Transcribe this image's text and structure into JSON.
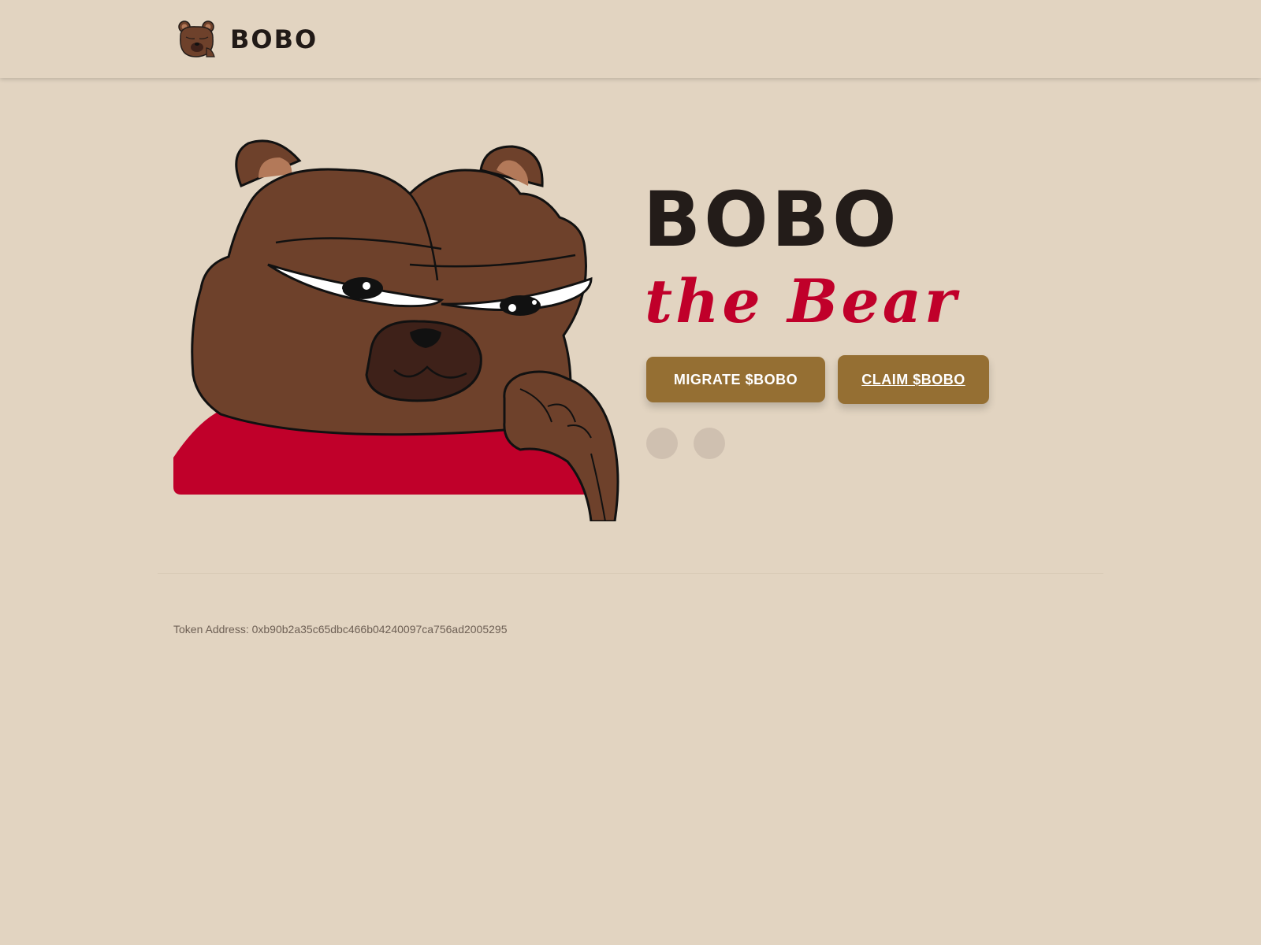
{
  "header": {
    "logo_icon": "bear-face-icon",
    "brand": "BOBO"
  },
  "hero": {
    "title": "BOBO",
    "subtitle": "the Bear",
    "image": "bear-thinking-illustration",
    "buttons": {
      "migrate": "MIGRATE $BOBO",
      "claim": "CLAIM $BOBO"
    },
    "social_icons": [
      "social-icon-1",
      "social-icon-2"
    ]
  },
  "footer": {
    "token_address": "Token Address: 0xb90b2a35c65dbc466b04240097ca756ad2005295"
  },
  "colors": {
    "background": "#e2d4c1",
    "bear_brown": "#6e412b",
    "accent_red": "#c0002a",
    "button": "#956f33",
    "text_dark": "#231c19"
  }
}
